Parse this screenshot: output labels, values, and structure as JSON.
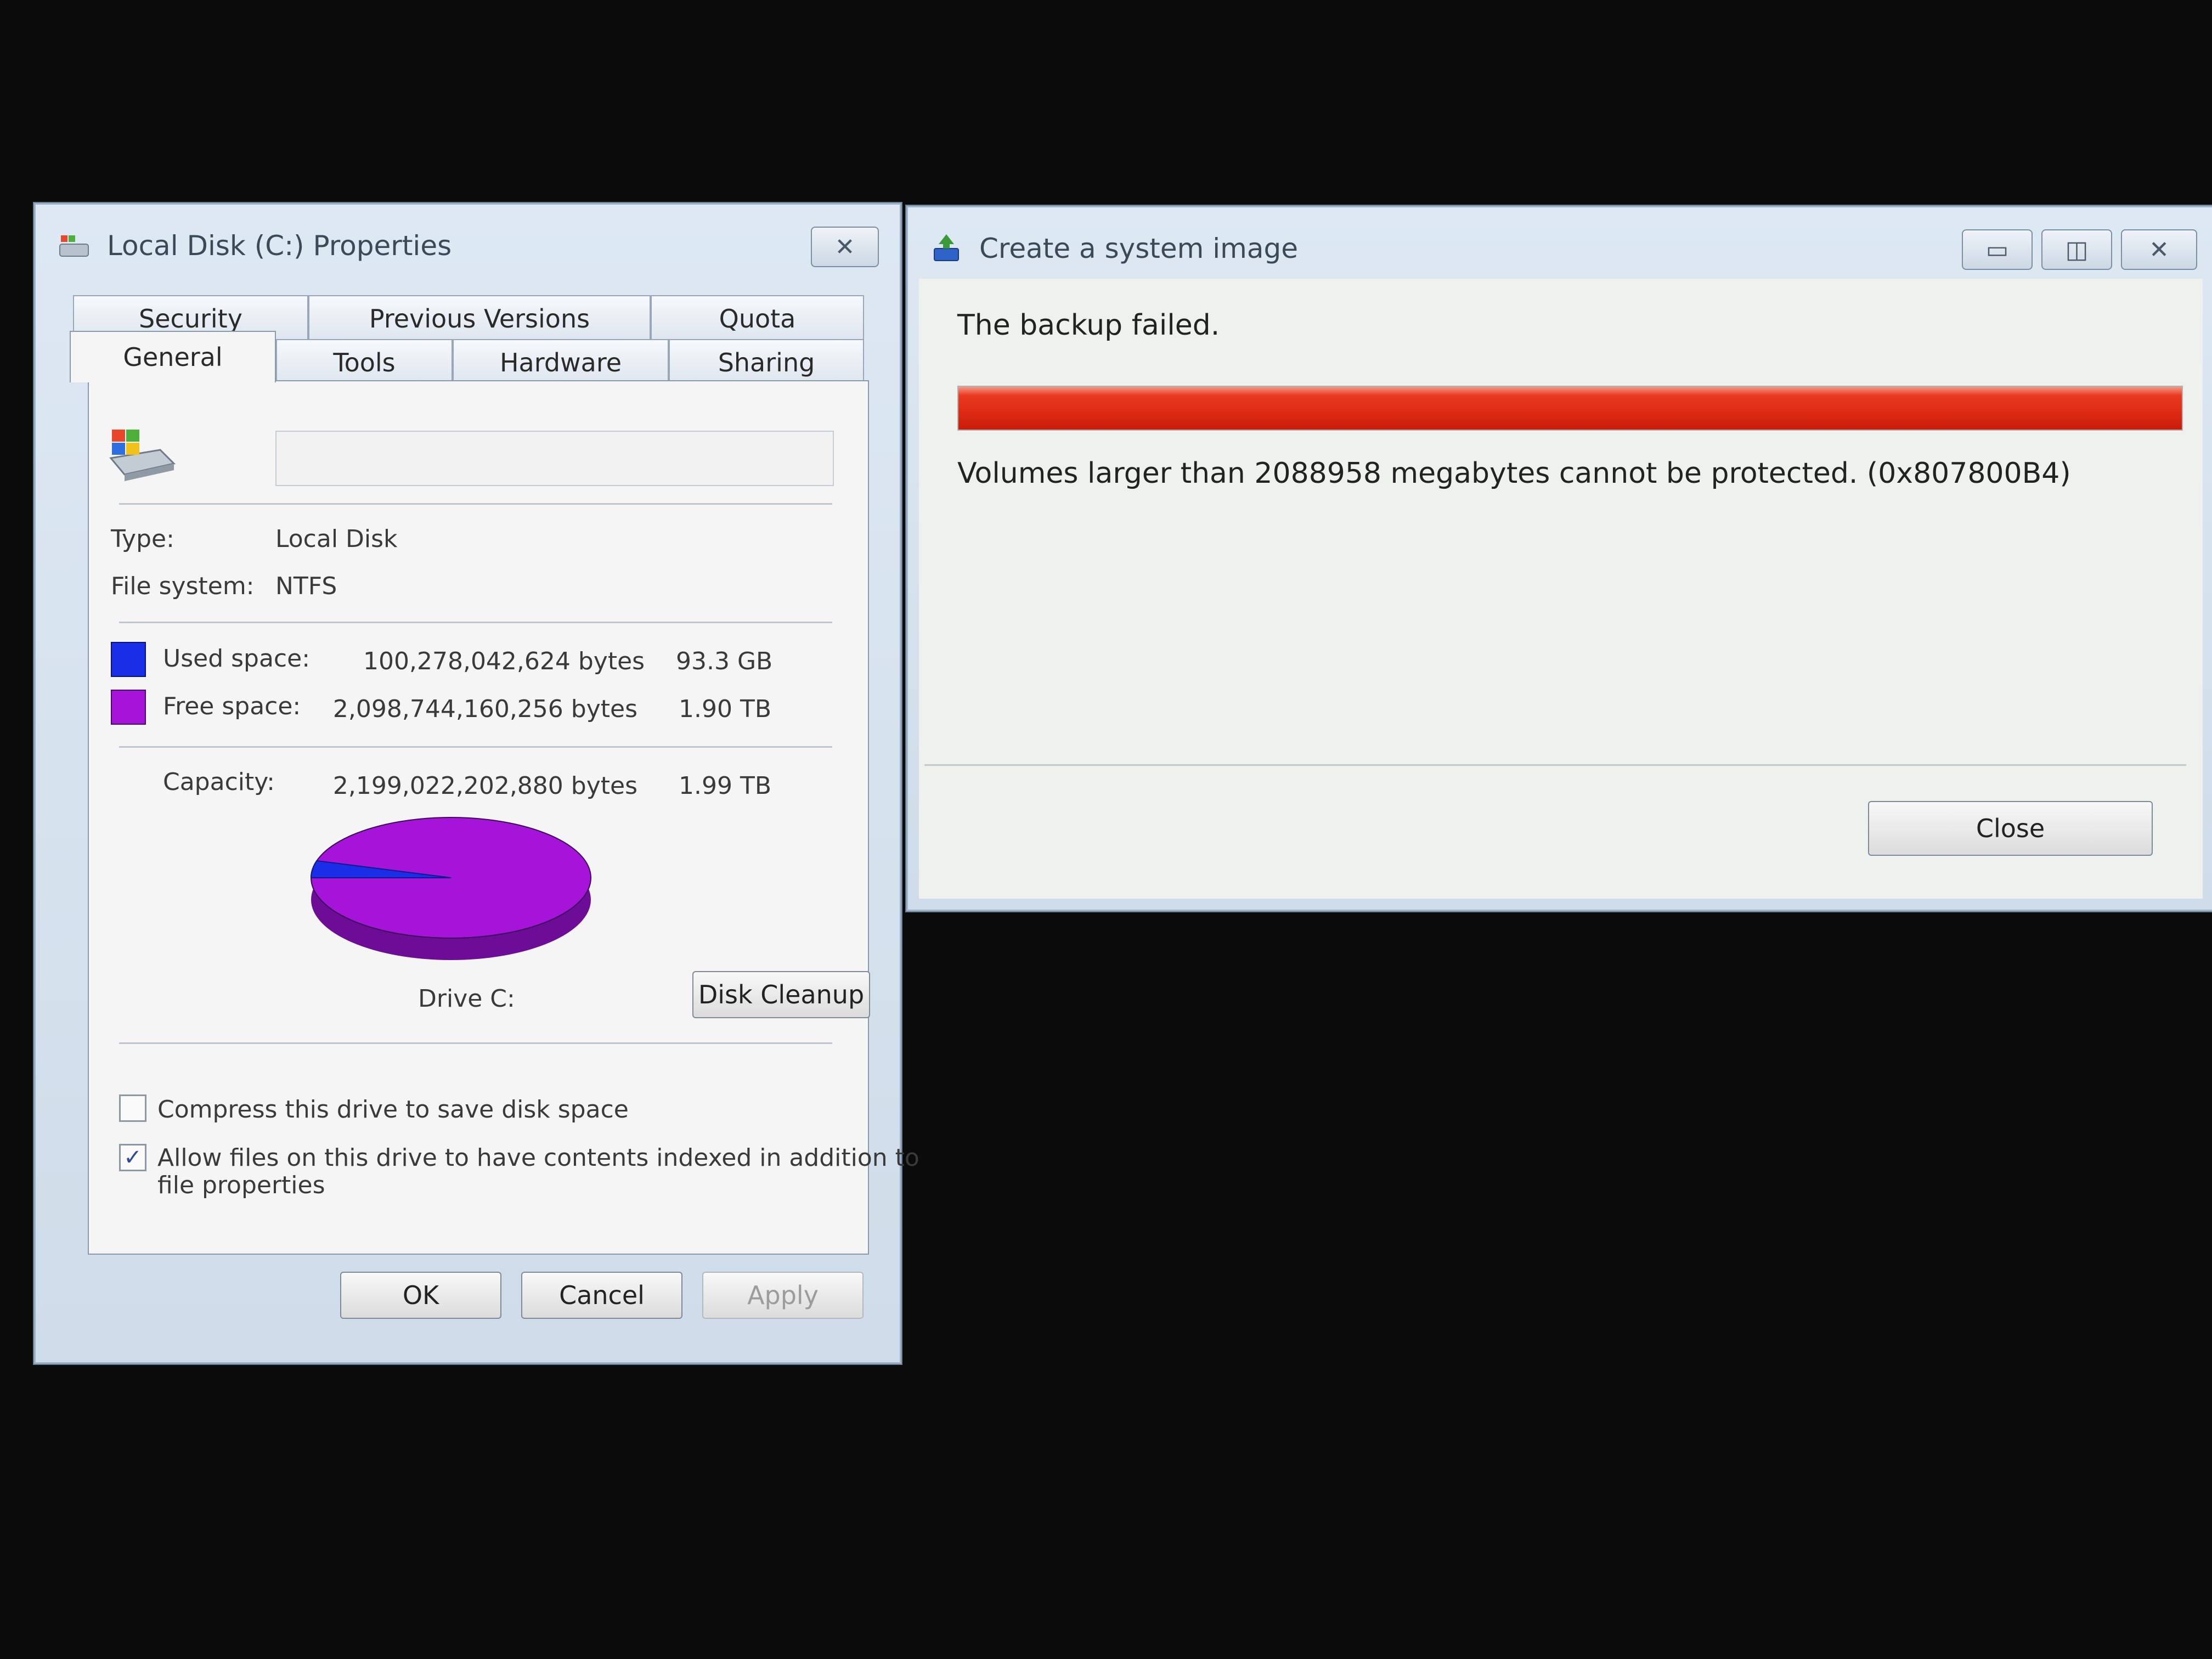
{
  "properties_dialog": {
    "title": "Local Disk (C:) Properties",
    "close_glyph": "✕",
    "tabs_row1": [
      "Security",
      "Previous Versions",
      "Quota"
    ],
    "tabs_row2": [
      "General",
      "Tools",
      "Hardware",
      "Sharing"
    ],
    "active_tab": "General",
    "drive_name_value": "",
    "type_label": "Type:",
    "type_value": "Local Disk",
    "fs_label": "File system:",
    "fs_value": "NTFS",
    "used_label": "Used space:",
    "used_bytes": "100,278,042,624 bytes",
    "used_human": "93.3 GB",
    "free_label": "Free space:",
    "free_bytes": "2,098,744,160,256 bytes",
    "free_human": "1.90 TB",
    "capacity_label": "Capacity:",
    "capacity_bytes": "2,199,022,202,880 bytes",
    "capacity_human": "1.99 TB",
    "drive_label": "Drive C:",
    "disk_cleanup_label": "Disk Cleanup",
    "compress_label": "Compress this drive to save disk space",
    "compress_checked": false,
    "index_label_line1": "Allow files on this drive to have contents indexed in addition to",
    "index_label_line2": "file properties",
    "index_checked": true,
    "ok_label": "OK",
    "cancel_label": "Cancel",
    "apply_label": "Apply",
    "colors": {
      "used": "#1a2ee8",
      "free": "#a514d8",
      "free_dark": "#6d0c96"
    },
    "used_fraction": 0.0456
  },
  "system_image_dialog": {
    "title": "Create a system image",
    "minimize_glyph": "▭",
    "maximize_glyph": "◫",
    "close_glyph": "✕",
    "status_text": "The backup failed.",
    "progress_fraction": 1.0,
    "progress_color": "#dd2a14",
    "error_message": "Volumes larger than 2088958 megabytes cannot be protected. (0x807800B4)",
    "close_button_label": "Close"
  }
}
